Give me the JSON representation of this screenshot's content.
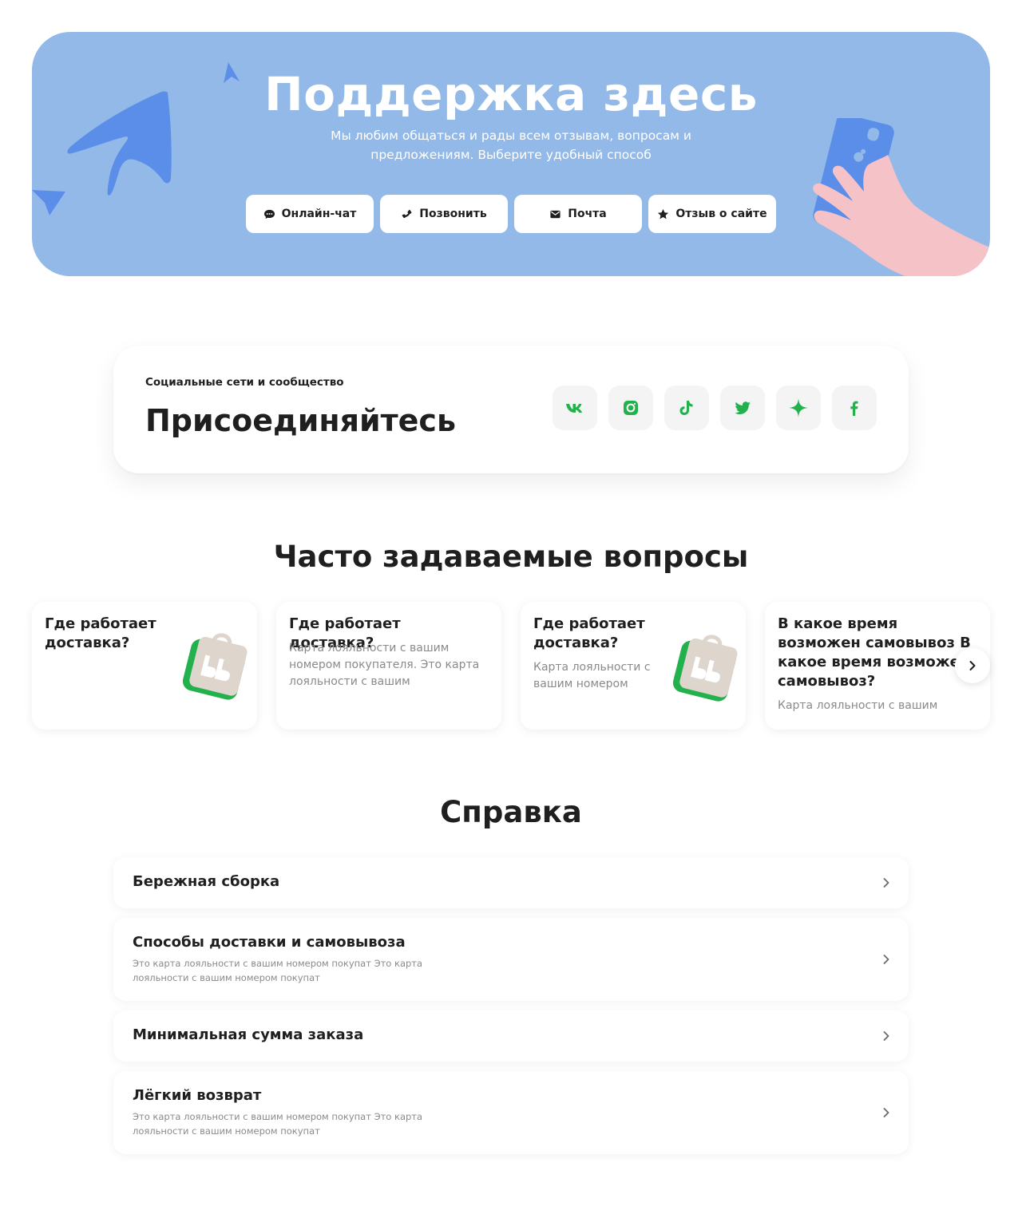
{
  "hero": {
    "title": "Поддержка здесь",
    "subtitle": "Мы любим общаться и рады всем отзывам, вопросам и предложениям. Выберите удобный способ",
    "buttons": [
      {
        "label": "Онлайн-чат",
        "icon": "chat-icon"
      },
      {
        "label": "Позвонить",
        "icon": "phone-icon"
      },
      {
        "label": "Почта",
        "icon": "mail-icon"
      },
      {
        "label": "Отзыв о сайте",
        "icon": "star-icon"
      }
    ],
    "colors": {
      "background": "#93b9e8",
      "plane": "#5b8ee8",
      "phone": "#5b8ee8",
      "hand": "#f5c2c7"
    }
  },
  "social": {
    "kicker": "Социальные сети и сообщество",
    "title": "Присоединяйтесь",
    "icons": [
      "vk-icon",
      "instagram-icon",
      "tiktok-icon",
      "twitter-icon",
      "sparkle-icon",
      "facebook-icon"
    ],
    "accent": "#22b14c"
  },
  "faq": {
    "heading": "Часто задаваемые вопросы",
    "cards": [
      {
        "question": "Где работает доставка?",
        "answer": ""
      },
      {
        "question": "Где работает доставка?",
        "answer": "Карта лояльности с вашим номером покупателя. Это карта лояльности с вашим"
      },
      {
        "question": "Где работает доставка?",
        "answer": "Карта лояльности с вашим номером"
      },
      {
        "question": "В какое время возможен самовывоз В какое время возможен самовывоз?",
        "answer": "Карта лояльности с вашим"
      }
    ]
  },
  "help": {
    "heading": "Справка",
    "items": [
      {
        "title": "Бережная сборка",
        "description": ""
      },
      {
        "title": "Способы доставки и самовывоза",
        "description": "Это карта лояльности с вашим номером покупат Это карта лояльности с вашим номером покупат"
      },
      {
        "title": "Минимальная сумма заказа",
        "description": ""
      },
      {
        "title": "Лёгкий возврат",
        "description": "Это карта лояльности с вашим номером покупат Это карта лояльности с вашим номером покупат"
      }
    ]
  }
}
